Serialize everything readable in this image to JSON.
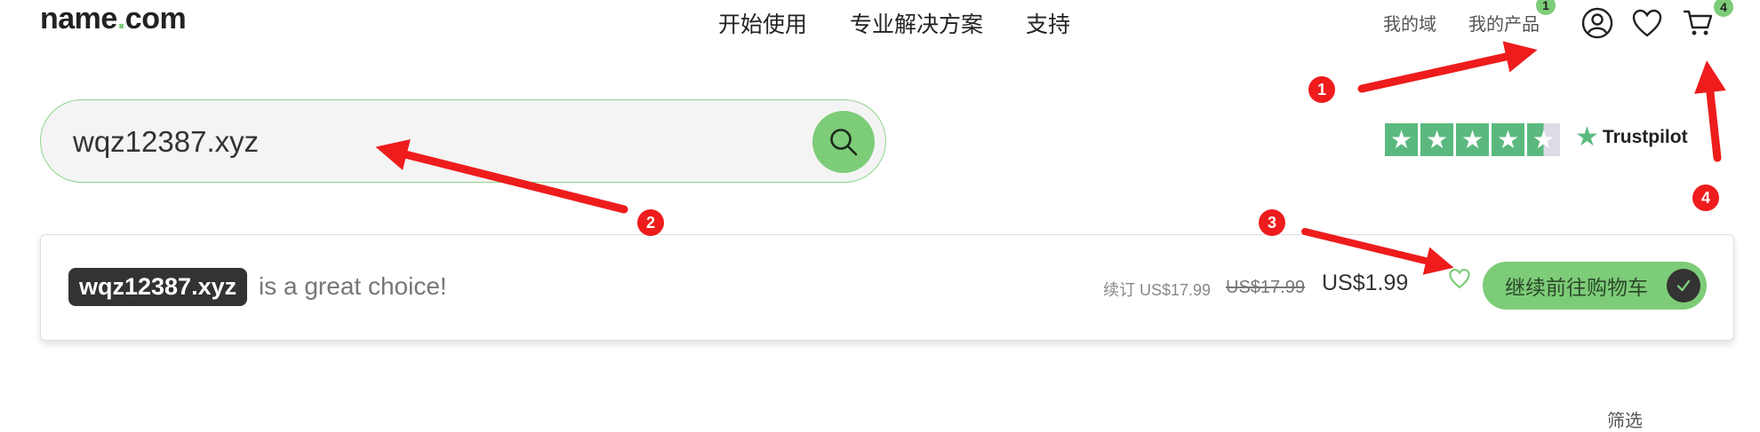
{
  "header": {
    "logo": {
      "name": "name",
      "dot": ".",
      "tld": "com"
    },
    "nav": [
      "开始使用",
      "专业解决方案",
      "支持"
    ],
    "links": [
      "我的域",
      "我的产品"
    ],
    "products_badge": "1",
    "cart_badge": "4"
  },
  "search": {
    "value": "wqz12387.xyz"
  },
  "trustpilot": {
    "brand": "Trustpilot",
    "stars": 4.5
  },
  "result": {
    "domain_name": "wqz12387",
    "domain_ext": ".xyz",
    "message": "is a great choice!",
    "renew_label": "续订 US$17.99",
    "old_price": "US$17.99",
    "price": "US$1.99",
    "cart_button": "继续前往购物车"
  },
  "filter_label": "筛选",
  "annotations": [
    "1",
    "2",
    "3",
    "4"
  ],
  "colors": {
    "accent": "#7dcc78",
    "annotation": "#ee1c1c",
    "trustpilot": "#5bb97f"
  }
}
